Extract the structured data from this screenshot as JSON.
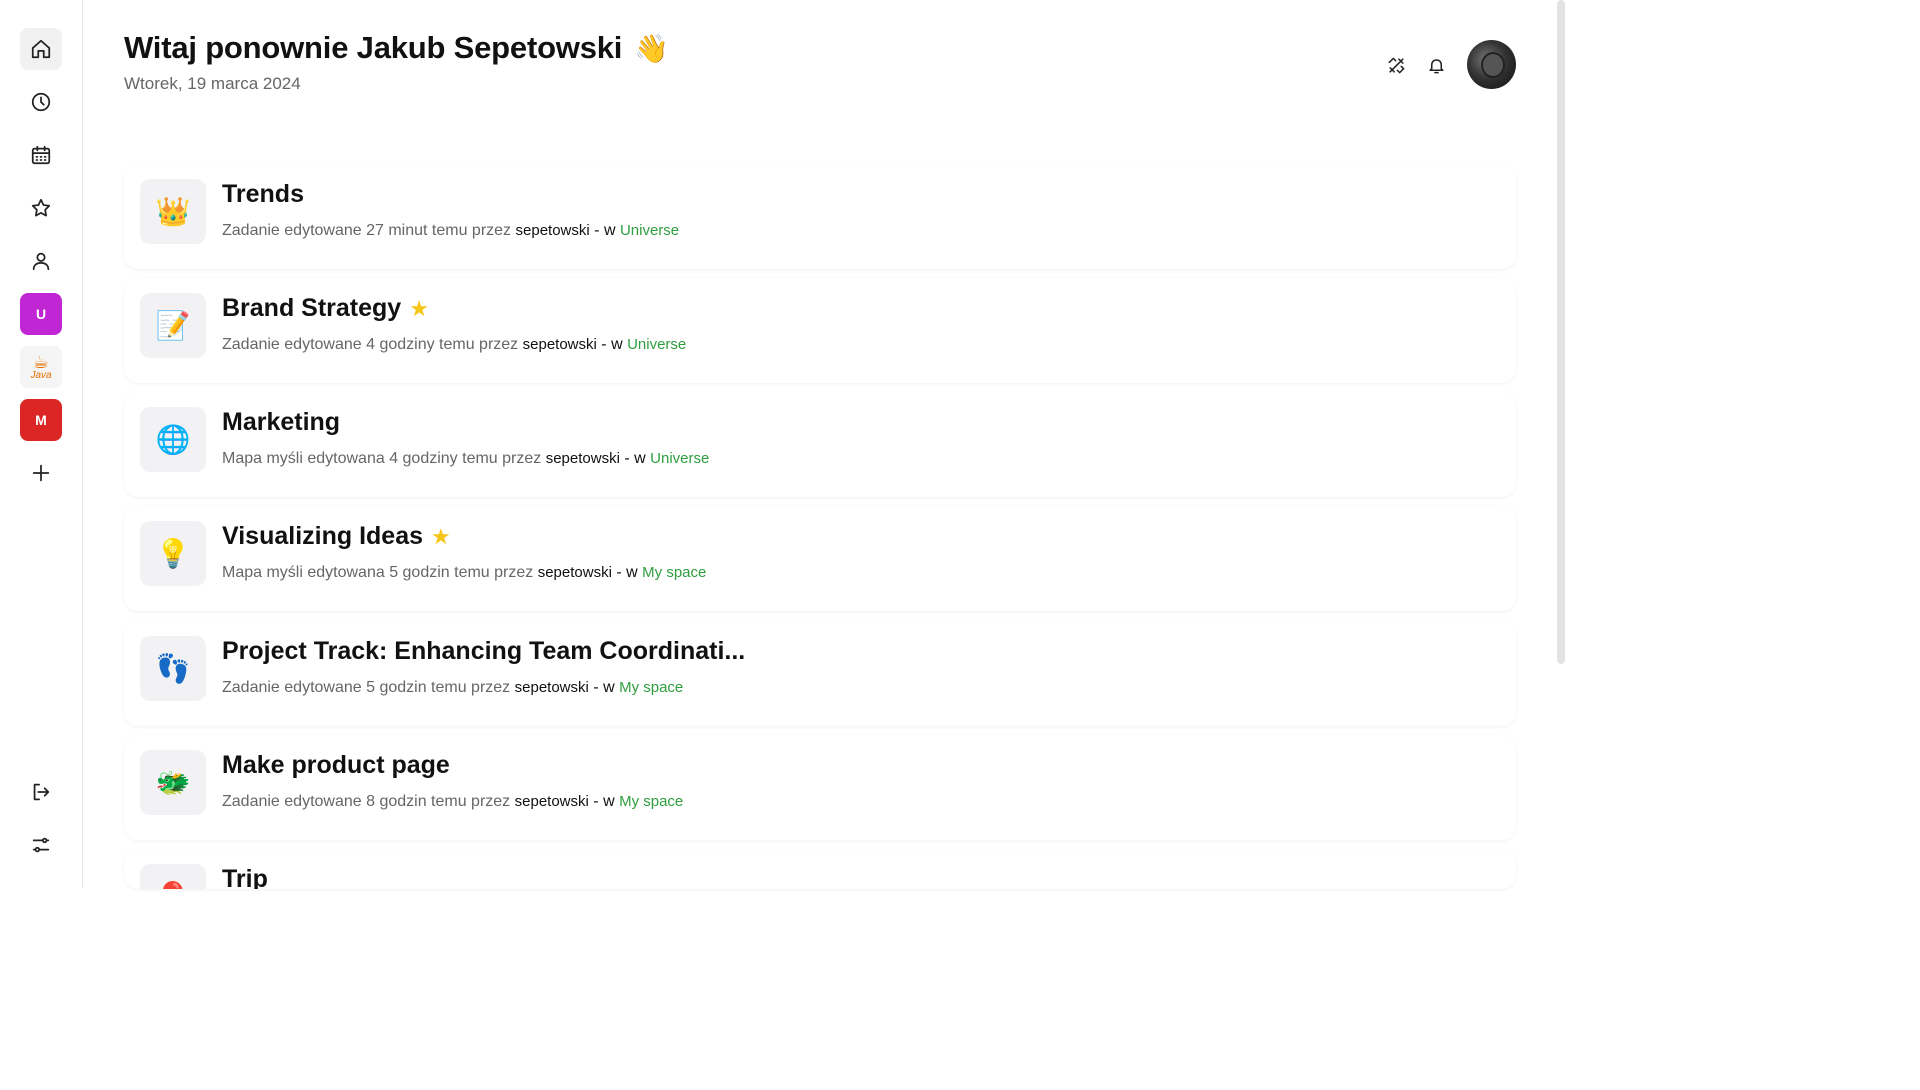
{
  "header": {
    "title": "Witaj ponownie Jakub Sepetowski",
    "emoji": "👋",
    "date": "Wtorek, 19 marca 2024"
  },
  "sidebar": {
    "items": [
      {
        "name": "home-icon",
        "active": true
      },
      {
        "name": "clock-icon"
      },
      {
        "name": "calendar-icon"
      },
      {
        "name": "star-icon"
      },
      {
        "name": "user-icon"
      }
    ],
    "spaces": [
      {
        "label": "U",
        "color": "#c026d3"
      },
      {
        "label": "Java",
        "color": "#f5f5f5"
      },
      {
        "label": "M",
        "color": "#dc2626"
      }
    ]
  },
  "recent": [
    {
      "title": "Trends",
      "icon": "👑",
      "starred": false,
      "meta": "Zadanie edytowane 27 minut temu przez",
      "user": "sepetowski",
      "sep": "- w",
      "space": "Universe"
    },
    {
      "title": "Brand Strategy",
      "icon": "📝",
      "starred": true,
      "meta": "Zadanie edytowane 4 godziny temu przez",
      "user": "sepetowski",
      "sep": "- w",
      "space": "Universe"
    },
    {
      "title": "Marketing",
      "icon": "🌐",
      "starred": false,
      "meta": "Mapa myśli edytowana 4 godziny temu przez",
      "user": "sepetowski",
      "sep": "- w",
      "space": "Universe"
    },
    {
      "title": "Visualizing Ideas",
      "icon": "💡",
      "starred": true,
      "meta": "Mapa myśli edytowana 5 godzin temu przez",
      "user": "sepetowski",
      "sep": "- w",
      "space": "My space"
    },
    {
      "title": "Project Track: Enhancing Team Coordinati...",
      "icon": "👣",
      "starred": false,
      "meta": "Zadanie edytowane 5 godzin temu przez",
      "user": "sepetowski",
      "sep": "- w",
      "space": "My space"
    },
    {
      "title": "Make product page",
      "icon": "🐲",
      "starred": false,
      "meta": "Zadanie edytowane 8 godzin temu przez",
      "user": "sepetowski",
      "sep": "- w",
      "space": "My space"
    },
    {
      "title": "Trip",
      "icon": "🎈",
      "starred": false,
      "meta": "",
      "user": "",
      "sep": "",
      "space": ""
    }
  ],
  "star_glyph": "★"
}
